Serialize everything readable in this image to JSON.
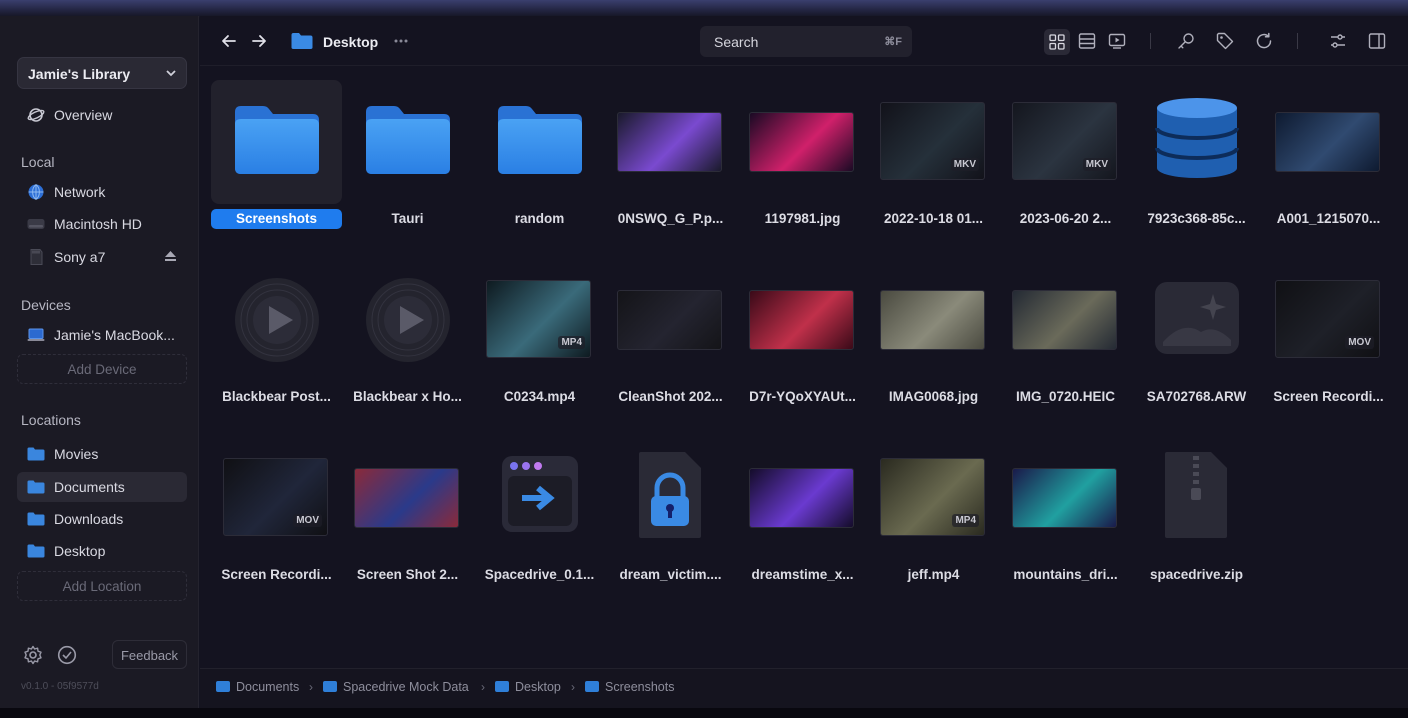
{
  "window": {
    "traffic_colors": [
      "#ee5f57",
      "#f6bd3c",
      "#5fc43f"
    ]
  },
  "sidebar": {
    "library": "Jamie's Library",
    "overview": "Overview",
    "local_heading": "Local",
    "local": [
      {
        "label": "Network",
        "icon": "globe-icon"
      },
      {
        "label": "Macintosh HD",
        "icon": "drive-icon"
      },
      {
        "label": "Sony a7",
        "icon": "sd-card-icon"
      }
    ],
    "devices_heading": "Devices",
    "device": "Jamie's MacBook...",
    "add_device": "Add Device",
    "locations_heading": "Locations",
    "locations": [
      {
        "label": "Movies"
      },
      {
        "label": "Documents"
      },
      {
        "label": "Downloads"
      },
      {
        "label": "Desktop"
      }
    ],
    "add_location": "Add Location",
    "feedback": "Feedback",
    "version": "v0.1.0 - 05f9577d"
  },
  "toolbar": {
    "title": "Desktop",
    "search_placeholder": "Search",
    "search_shortcut": "⌘F"
  },
  "files": [
    {
      "name": "Screenshots",
      "kind": "folder",
      "selected": true
    },
    {
      "name": "Tauri",
      "kind": "folder"
    },
    {
      "name": "random",
      "kind": "folder"
    },
    {
      "name": "0NSWQ_G_P.p...",
      "kind": "image",
      "colors": [
        "#1a1a2c",
        "#7a4ad0"
      ]
    },
    {
      "name": "1197981.jpg",
      "kind": "image",
      "colors": [
        "#1a0a24",
        "#d0206a"
      ]
    },
    {
      "name": "2022-10-18 01...",
      "kind": "video",
      "badge": "MKV",
      "colors": [
        "#12121a",
        "#25303a"
      ]
    },
    {
      "name": "2023-06-20 2...",
      "kind": "video",
      "badge": "MKV",
      "colors": [
        "#14161e",
        "#2b3440"
      ]
    },
    {
      "name": "7923c368-85c...",
      "kind": "database"
    },
    {
      "name": "A001_1215070...",
      "kind": "image",
      "colors": [
        "#0e1a30",
        "#304a70"
      ]
    },
    {
      "name": "Blackbear Post...",
      "kind": "audio"
    },
    {
      "name": "Blackbear x Ho...",
      "kind": "audio"
    },
    {
      "name": "C0234.mp4",
      "kind": "video",
      "badge": "MP4",
      "colors": [
        "#0e1a20",
        "#3a6a7a"
      ]
    },
    {
      "name": "CleanShot 202...",
      "kind": "image",
      "colors": [
        "#141418",
        "#242430"
      ]
    },
    {
      "name": "D7r-YQoXYAUt...",
      "kind": "image",
      "colors": [
        "#3a0a18",
        "#c0304a"
      ]
    },
    {
      "name": "IMAG0068.jpg",
      "kind": "image",
      "colors": [
        "#4a4a40",
        "#8a8a7a"
      ]
    },
    {
      "name": "IMG_0720.HEIC",
      "kind": "image",
      "colors": [
        "#242a34",
        "#6a6a5a"
      ]
    },
    {
      "name": "SA702768.ARW",
      "kind": "raw"
    },
    {
      "name": "Screen Recordi...",
      "kind": "video",
      "badge": "MOV",
      "colors": [
        "#101014",
        "#1e2028"
      ]
    },
    {
      "name": "Screen Recordi...",
      "kind": "video",
      "badge": "MOV",
      "colors": [
        "#101014",
        "#20263a"
      ]
    },
    {
      "name": "Screen Shot 2...",
      "kind": "image",
      "colors": [
        "#8a2a3a",
        "#2a3a8a"
      ]
    },
    {
      "name": "Spacedrive_0.1...",
      "kind": "installer"
    },
    {
      "name": "dream_victim....",
      "kind": "locked"
    },
    {
      "name": "dreamstime_x...",
      "kind": "image",
      "colors": [
        "#140c2a",
        "#6a3ad0"
      ]
    },
    {
      "name": "jeff.mp4",
      "kind": "video",
      "badge": "MP4",
      "colors": [
        "#2a2a20",
        "#6a6a50"
      ]
    },
    {
      "name": "mountains_dri...",
      "kind": "image",
      "colors": [
        "#1a1a4a",
        "#20a0a0"
      ]
    },
    {
      "name": "spacedrive.zip",
      "kind": "zip"
    }
  ],
  "pathbar": [
    "Documents",
    "Spacedrive Mock Data",
    "Desktop",
    "Screenshots"
  ]
}
